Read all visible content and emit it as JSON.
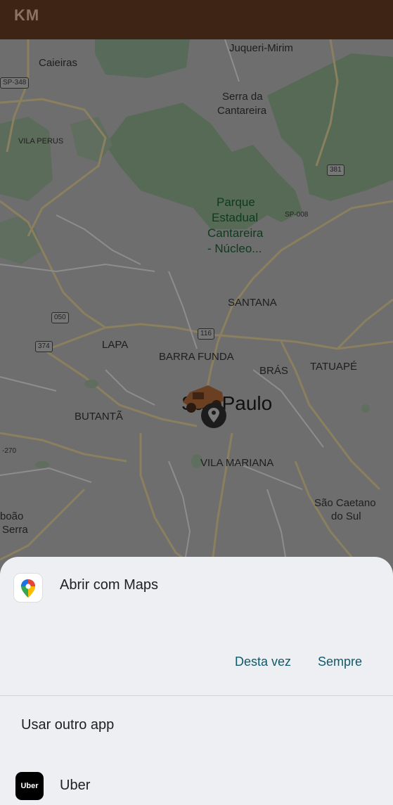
{
  "app_bar": {
    "title": "KM"
  },
  "map": {
    "places": {
      "juqueri": "Juqueri-Mirim",
      "caieiras": "Caieiras",
      "serra_l1": "Serra da",
      "serra_l2": "Cantareira",
      "vila_perus": "VILA PERUS",
      "parque_l1": "Parque",
      "parque_l2": "Estadual",
      "parque_l3": "Cantareira",
      "parque_l4": "- Núcleo...",
      "santana": "SANTANA",
      "lapa": "LAPA",
      "barra_funda": "BARRA FUNDA",
      "bras": "BRÁS",
      "tatuape": "TATUAPÉ",
      "sao_paulo": "São Paulo",
      "butanta": "BUTANTÃ",
      "vila_mariana": "VILA MARIANA",
      "sao_caetano_l1": "São Caetano",
      "sao_caetano_l2": "do Sul",
      "boao_l1": "boão",
      "boao_l2": "Serra"
    },
    "route_shields": {
      "sp348": "SP-348",
      "r381": "381",
      "sp008": "SP-008",
      "r050": "050",
      "r116": "116",
      "r374": "374",
      "r270": "-270"
    }
  },
  "sheet": {
    "open_with_label": "Abrir com Maps",
    "once_button": "Desta vez",
    "always_button": "Sempre",
    "other_app_label": "Usar outro app",
    "uber_icon_text": "Uber",
    "uber_label": "Uber"
  },
  "colors": {
    "app_bar": "#3e2414",
    "scrim_map": "#6d6d6d",
    "sheet_bg": "#eeeff2",
    "accent_button": "#0f5a6b"
  }
}
